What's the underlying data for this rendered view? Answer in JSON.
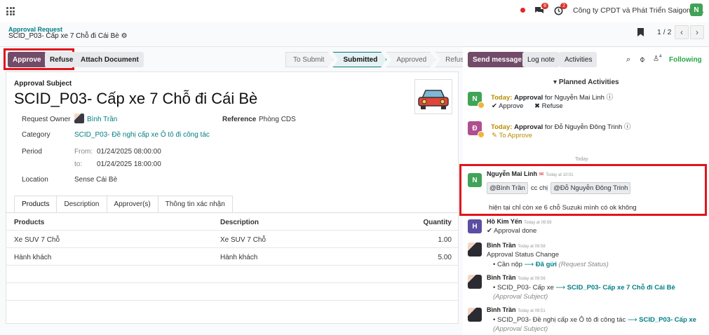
{
  "topbar": {
    "badge_msgs": "8",
    "badge_activity": "2",
    "company": "Công ty CPDT và Phát Triển Saigon C...",
    "user_initial": "N"
  },
  "breadcrumb": {
    "parent": "Approval Request",
    "current": "SCID_P03- Cấp xe 7 Chỗ đi Cái Bè"
  },
  "pager": {
    "text": "1 / 2"
  },
  "actions": {
    "approve": "Approve",
    "refuse": "Refuse",
    "attach": "Attach Document"
  },
  "statusbar": [
    "To Submit",
    "Submitted",
    "Approved",
    "Refused"
  ],
  "form": {
    "subject_label": "Approval Subject",
    "title": "SCID_P03- Cấp xe 7 Chỗ đi Cái Bè",
    "owner_label": "Request Owner",
    "owner": "Bình Trần",
    "reference_label": "Reference",
    "reference": "Phòng CDS",
    "category_label": "Category",
    "category": "SCID_P03- Đề nghị cấp xe Ô tô đi công tác",
    "period_label": "Period",
    "from_label": "From:",
    "from": "01/24/2025 08:00:00",
    "to_label": "to:",
    "to": "01/24/2025 18:00:00",
    "location_label": "Location",
    "location": "Sense Cái Bè"
  },
  "tabs": [
    "Products",
    "Description",
    "Approver(s)",
    "Thông tin xác nhận"
  ],
  "table": {
    "headers": [
      "Products",
      "Description",
      "Quantity"
    ],
    "rows": [
      [
        "Xe SUV 7 Chỗ",
        "Xe SUV 7 Chỗ",
        "1.00"
      ],
      [
        "Hành khách",
        "Hành khách",
        "5.00"
      ]
    ]
  },
  "chatter": {
    "send": "Send message",
    "log": "Log note",
    "activities": "Activities",
    "followers": "4",
    "following": "Following",
    "planned": "Planned Activities",
    "act1": {
      "initial": "N",
      "today": "Today:",
      "type": "Approval",
      "for": "for Nguyễn Mai Linh",
      "approve": "Approve",
      "refuse": "Refuse"
    },
    "act2": {
      "initial": "Đ",
      "today": "Today:",
      "type": "Approval",
      "for": "for Đỗ Nguyễn Đông Trinh",
      "to_approve": "To Approve"
    },
    "today": "Today",
    "msg1": {
      "initial": "N",
      "name": "Nguyễn Mai Linh",
      "time": "Today at 10:01",
      "mention1": "@Bình Trần",
      "cc": "cc chị",
      "mention2": "@Đỗ Nguyễn Đông Trinh",
      "body": "hiện tại chỉ còn xe 6 chỗ Suzuki mình có ok không"
    },
    "msg2": {
      "initial": "H",
      "name": "Hồ Kim Yến",
      "time": "Today at 09:59",
      "body": "Approval done"
    },
    "msg3": {
      "name": "Bình Trần",
      "time": "Today at 09:58",
      "body": "Approval Status Change",
      "old": "Cần nộp",
      "new": "Đã gửi",
      "field": "(Request Status)"
    },
    "msg4": {
      "name": "Bình Trần",
      "time": "Today at 09:56",
      "old": "SCID_P03- Cấp xe",
      "new": "SCID_P03- Cấp xe 7 Chỗ đi Cái Bè",
      "field": "(Approval Subject)"
    },
    "msg5": {
      "name": "Bình Trần",
      "time": "Today at 09:51",
      "old": "SCID_P03- Đề nghị cấp xe Ô tô đi công tác",
      "new": "SCID_P03- Cấp xe",
      "field": "(Approval Subject)"
    }
  },
  "colors": {
    "primary": "#714b67",
    "teal": "#017e84",
    "highlight": "#e0151c"
  }
}
